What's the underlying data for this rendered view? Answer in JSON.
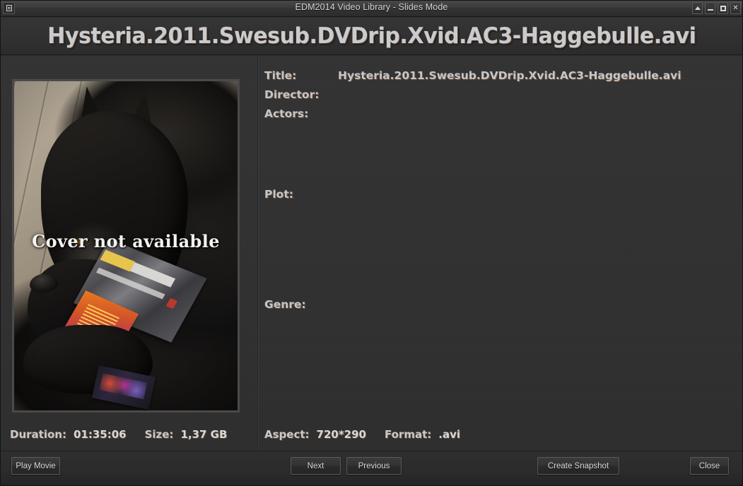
{
  "window": {
    "title": "EDM2014 Video Library - Slides Mode",
    "sys_menu_icon": "menu-icon",
    "buttons": [
      {
        "name": "rollup-button",
        "icon": "triangle-up-icon"
      },
      {
        "name": "minimize-button",
        "icon": "minus-icon"
      },
      {
        "name": "maximize-button",
        "icon": "square-icon"
      },
      {
        "name": "close-button",
        "icon": "x-icon",
        "glyph": "✕"
      }
    ]
  },
  "header": {
    "title": "Hysteria.2011.Swesub.DVDrip.Xvid.AC3-Haggebulle.avi"
  },
  "cover": {
    "caption": "Cover not available",
    "alt": "black dog lying on wooden floor with dvd cases"
  },
  "fields": {
    "title_label": "Title:",
    "title_value": "Hysteria.2011.Swesub.DVDrip.Xvid.AC3-Haggebulle.avi",
    "director_label": "Director:",
    "director_value": "",
    "actors_label": "Actors:",
    "actors_value": "",
    "plot_label": "Plot:",
    "plot_value": "",
    "genre_label": "Genre:",
    "genre_value": ""
  },
  "info": {
    "duration_label": "Duration:",
    "duration_value": "01:35:06",
    "size_label": "Size:",
    "size_value": "1,37 GB",
    "aspect_label": "Aspect:",
    "aspect_value": "720*290",
    "format_label": "Format:",
    "format_value": ".avi"
  },
  "footer": {
    "play_movie": "Play Movie",
    "next": "Next",
    "previous": "Previous",
    "create_snapshot": "Create Snapshot",
    "close": "Close"
  },
  "colors": {
    "window_bg": "#2e2e2e",
    "panel_bg": "#333333",
    "titlebar_bg": "#3b3b3b",
    "text": "#c7cace",
    "text_shadow": "#7a5334",
    "button_border": "#5b5b5b"
  }
}
